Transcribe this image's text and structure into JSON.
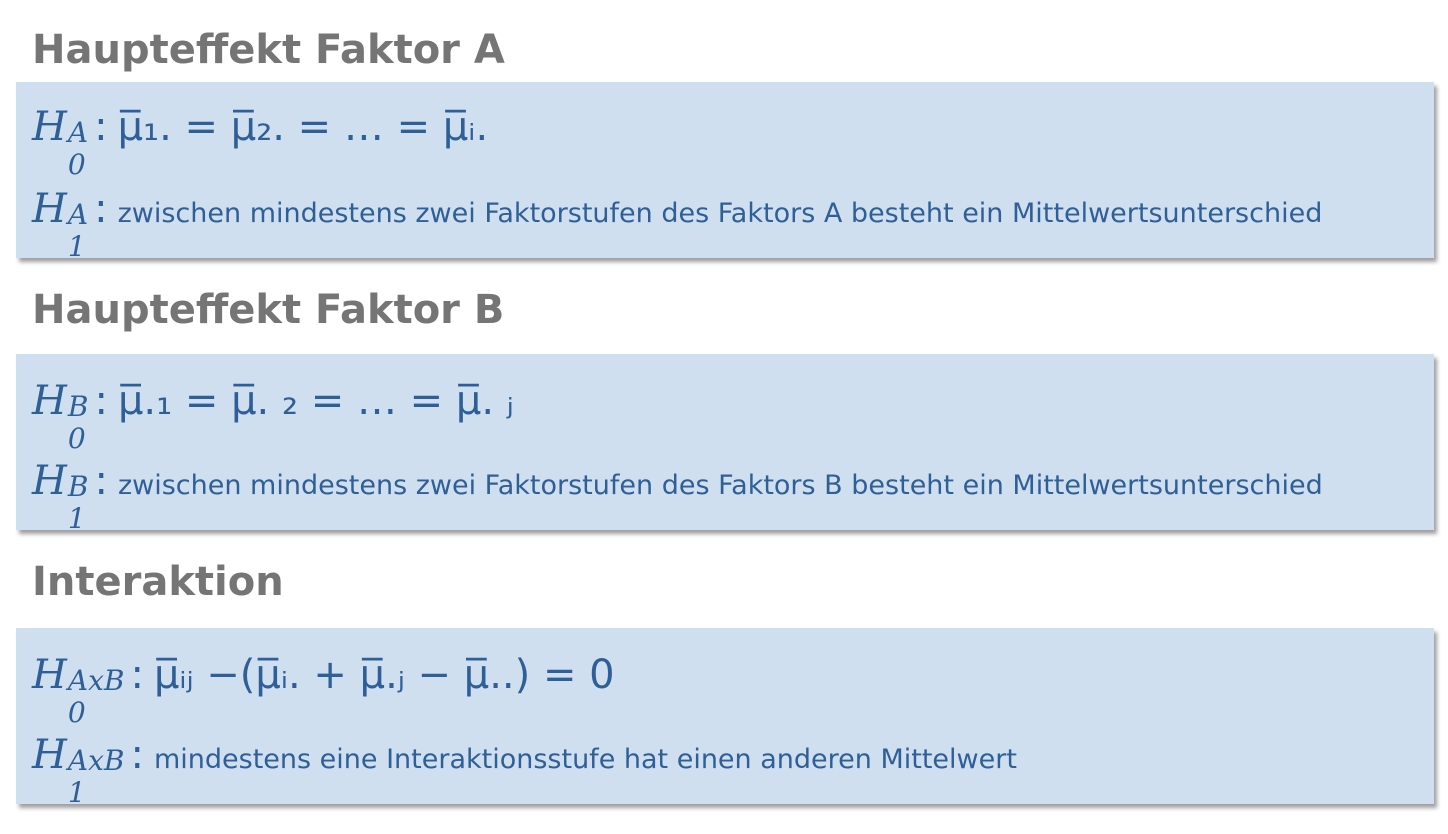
{
  "sections": [
    {
      "heading": "Haupteffekt Faktor A",
      "h0": {
        "H": "H",
        "sup": "A",
        "sub": "0",
        "colon": ":",
        "expression": "μ̅₁. = μ̅₂. = … = μ̅ᵢ."
      },
      "h1": {
        "H": "H",
        "sup": "A",
        "sub": "1",
        "colon": ":",
        "text": "zwischen mindestens zwei Faktorstufen des Faktors A besteht ein Mittelwertsunterschied"
      }
    },
    {
      "heading": "Haupteffekt Faktor B",
      "h0": {
        "H": "H",
        "sup": "B",
        "sub": "0",
        "colon": ":",
        "expression": "μ̅.₁ = μ̅. ₂ = … = μ̅. ⱼ"
      },
      "h1": {
        "H": "H",
        "sup": "B",
        "sub": "1",
        "colon": ":",
        "text": "zwischen mindestens zwei Faktorstufen des Faktors B besteht ein Mittelwertsunterschied"
      }
    },
    {
      "heading": "Interaktion",
      "h0": {
        "H": "H",
        "sup": "AxB",
        "sub": "0",
        "colon": ":",
        "expression": "μ̅ᵢⱼ −(μ̅ᵢ. + μ̅.ⱼ − μ̅..) = 0"
      },
      "h1": {
        "H": "H",
        "sup": "AxB",
        "sub": "1",
        "colon": ":",
        "text": "mindestens eine Interaktionsstufe hat einen anderen Mittelwert"
      }
    }
  ],
  "colors": {
    "heading": "#757575",
    "box_background": "#cfdff0",
    "formula_text": "#2f5f97"
  }
}
